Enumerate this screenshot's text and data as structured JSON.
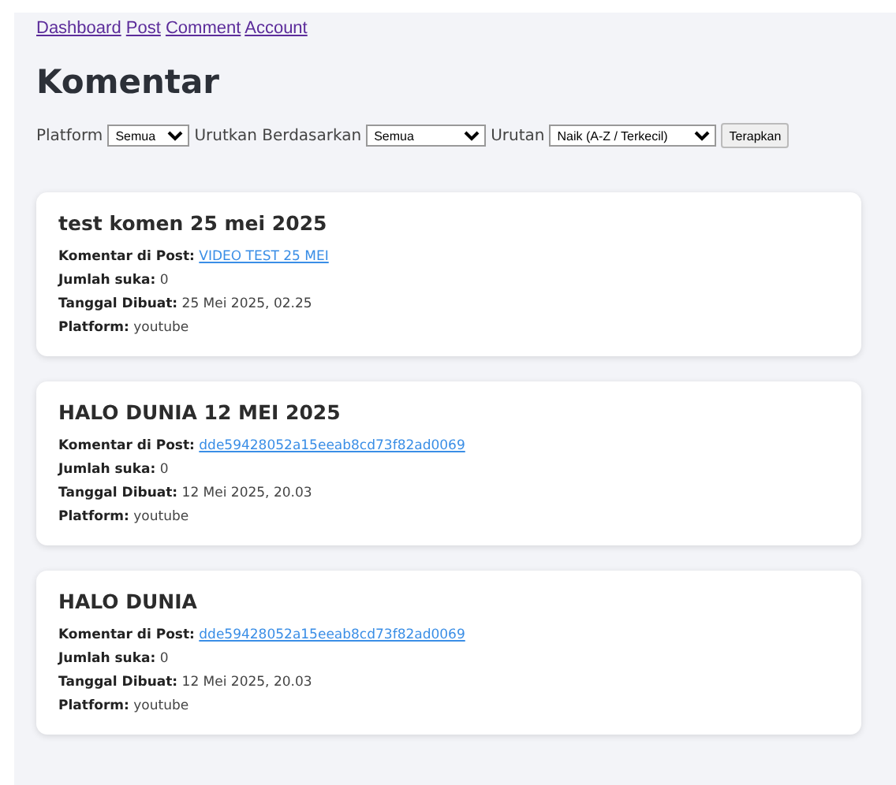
{
  "nav": [
    {
      "label": "Dashboard"
    },
    {
      "label": "Post"
    },
    {
      "label": "Comment"
    },
    {
      "label": "Account"
    }
  ],
  "title": "Komentar",
  "filters": [
    {
      "label": "Platform",
      "value": "Semua"
    },
    {
      "label": "Urutkan Berdasarkan",
      "value": "Semua"
    },
    {
      "label": "Urutan",
      "value": "Naik (A-Z / Terkecil)"
    }
  ],
  "apply_button": "Terapkan",
  "comments": [
    {
      "title": "test komen 25 mei 2025",
      "fields": [
        {
          "label": "Komentar di Post:",
          "value": "VIDEO TEST 25 MEI",
          "kind": "link"
        },
        {
          "label": "Jumlah suka:",
          "value": "0",
          "kind": "text"
        },
        {
          "label": "Tanggal Dibuat:",
          "value": "25 Mei 2025, 02.25",
          "kind": "text"
        },
        {
          "label": "Platform:",
          "value": "youtube",
          "kind": "text"
        }
      ]
    },
    {
      "title": "HALO DUNIA 12 MEI 2025",
      "fields": [
        {
          "label": "Komentar di Post:",
          "value": "dde59428052a15eeab8cd73f82ad0069",
          "kind": "link"
        },
        {
          "label": "Jumlah suka:",
          "value": "0",
          "kind": "text"
        },
        {
          "label": "Tanggal Dibuat:",
          "value": "12 Mei 2025, 20.03",
          "kind": "text"
        },
        {
          "label": "Platform:",
          "value": "youtube",
          "kind": "text"
        }
      ]
    },
    {
      "title": "HALO DUNIA",
      "fields": [
        {
          "label": "Komentar di Post:",
          "value": "dde59428052a15eeab8cd73f82ad0069",
          "kind": "link"
        },
        {
          "label": "Jumlah suka:",
          "value": "0",
          "kind": "text"
        },
        {
          "label": "Tanggal Dibuat:",
          "value": "12 Mei 2025, 20.03",
          "kind": "text"
        },
        {
          "label": "Platform:",
          "value": "youtube",
          "kind": "text"
        }
      ]
    }
  ]
}
